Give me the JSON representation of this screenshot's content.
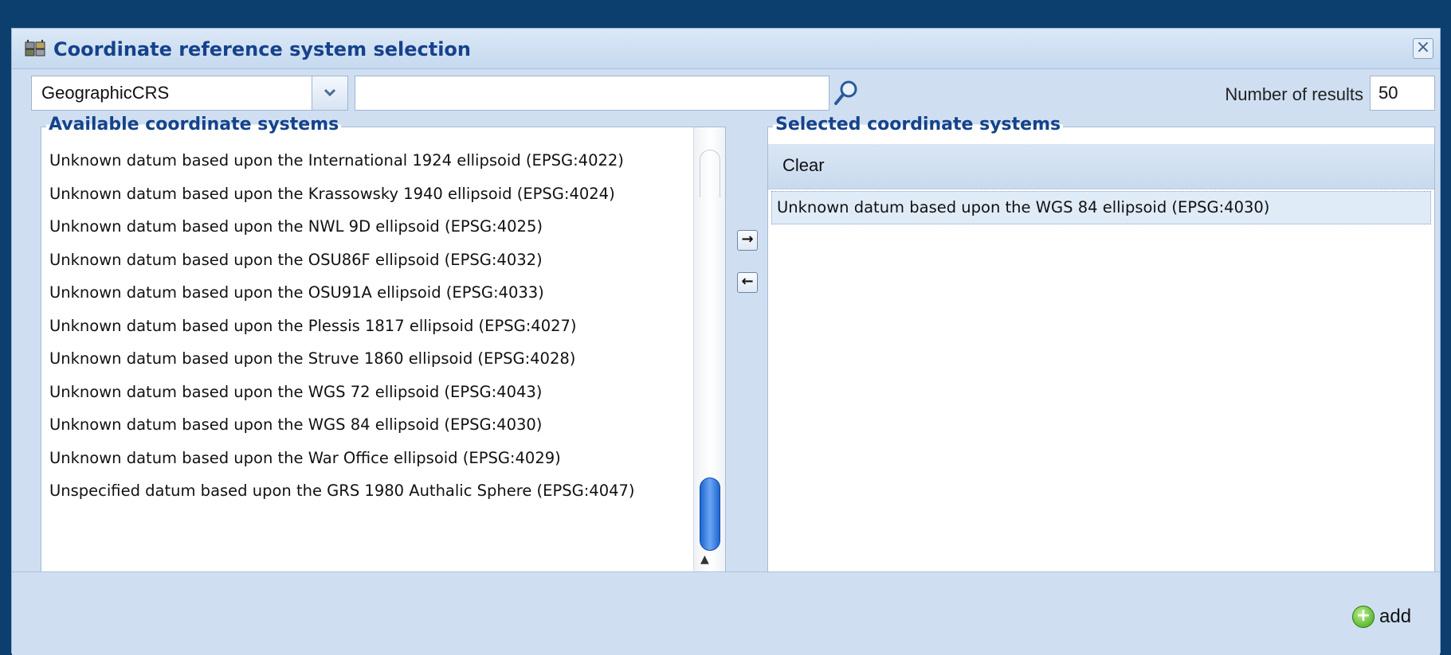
{
  "dialog": {
    "title": "Coordinate reference system selection",
    "close_symbol": "×"
  },
  "toolbar": {
    "crs_type_value": "GeographicCRS",
    "search_value": "",
    "results_label": "Number of results",
    "results_value": "50"
  },
  "available": {
    "legend": "Available coordinate systems",
    "items": [
      "Unknown datum based upon the International 1924 ellipsoid (EPSG:4022)",
      "Unknown datum based upon the Krassowsky 1940 ellipsoid (EPSG:4024)",
      "Unknown datum based upon the NWL 9D ellipsoid (EPSG:4025)",
      "Unknown datum based upon the OSU86F ellipsoid (EPSG:4032)",
      "Unknown datum based upon the OSU91A ellipsoid (EPSG:4033)",
      "Unknown datum based upon the Plessis 1817 ellipsoid (EPSG:4027)",
      "Unknown datum based upon the Struve 1860 ellipsoid (EPSG:4028)",
      "Unknown datum based upon the WGS 72 ellipsoid (EPSG:4043)",
      "Unknown datum based upon the WGS 84 ellipsoid (EPSG:4030)",
      "Unknown datum based upon the War Office ellipsoid (EPSG:4029)",
      "Unspecified datum based upon the GRS 1980 Authalic Sphere (EPSG:4047)"
    ]
  },
  "transfer": {
    "add_arrow": "→",
    "remove_arrow": "←"
  },
  "selected": {
    "legend": "Selected coordinate systems",
    "clear_label": "Clear",
    "items": [
      "Unknown datum based upon the WGS 84 ellipsoid (EPSG:4030)"
    ]
  },
  "footer": {
    "add_label": "add",
    "add_symbol": "+"
  },
  "icons": {
    "title": "globe-grid-icon",
    "search": "magnifier-icon",
    "dropdown": "chevron-down-icon",
    "add": "plus-circle-icon"
  }
}
